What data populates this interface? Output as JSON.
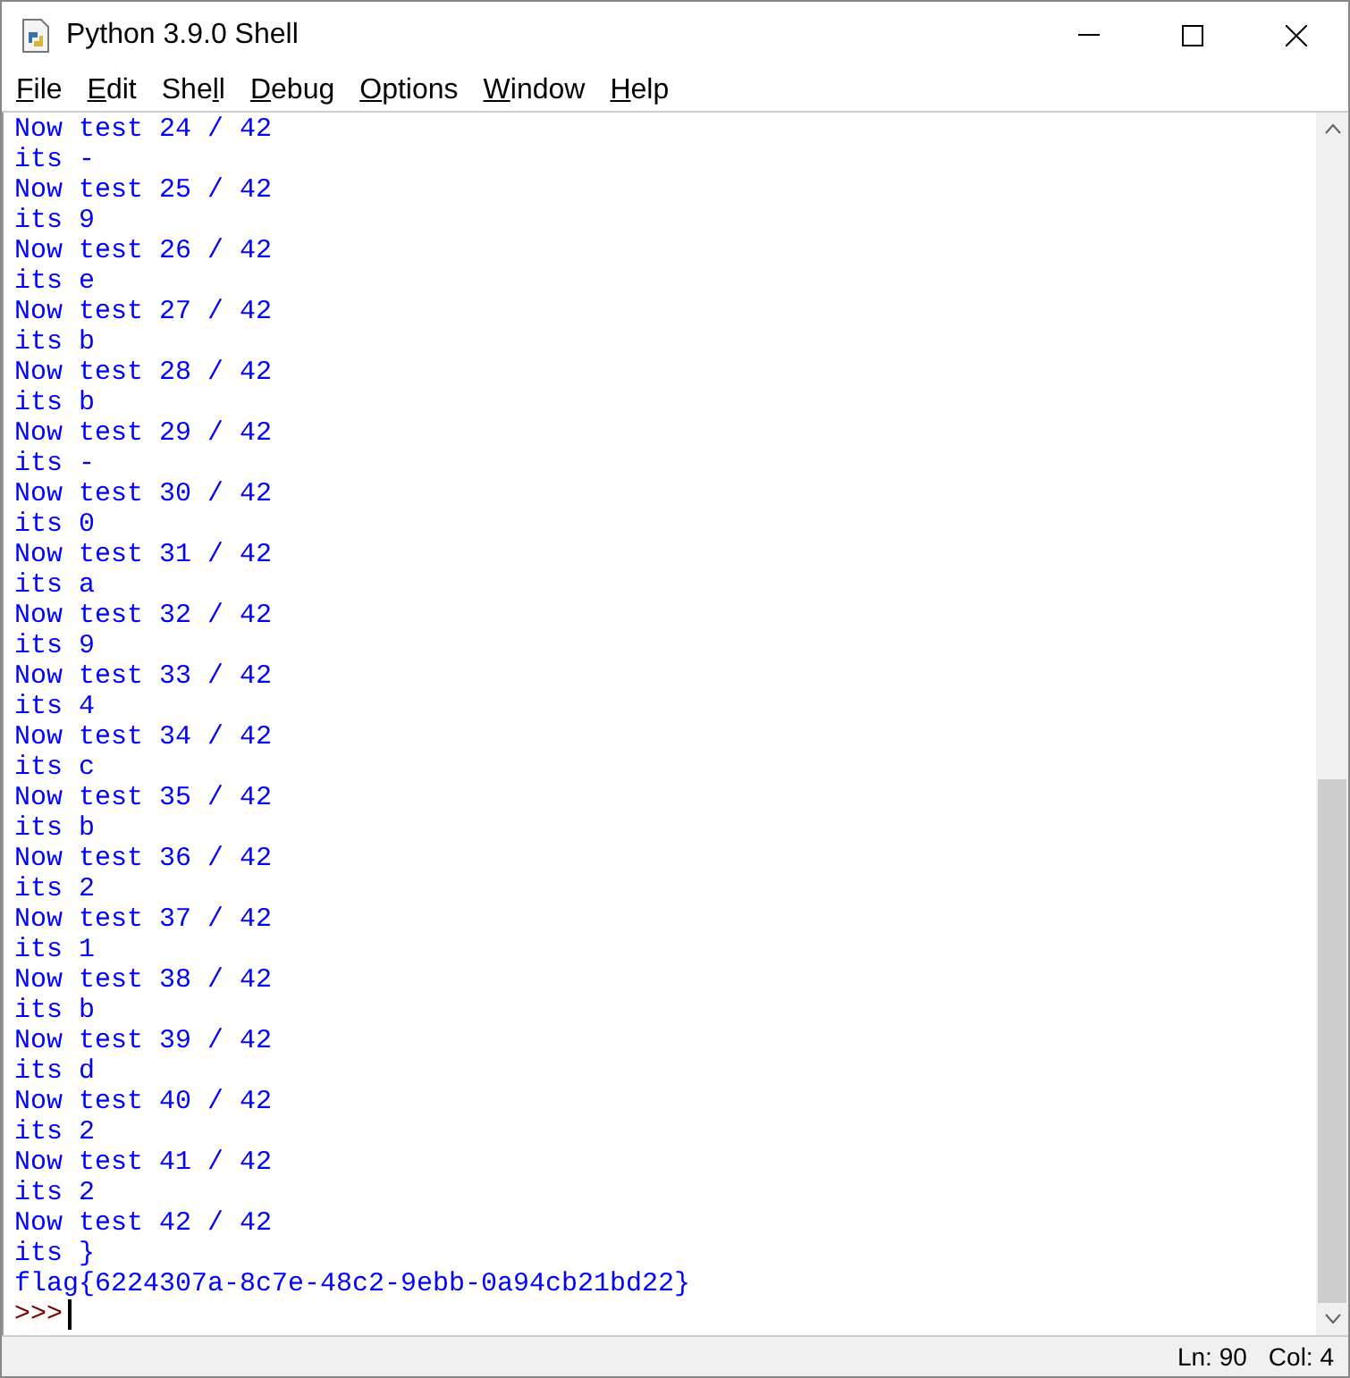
{
  "window": {
    "title": "Python 3.9.0 Shell"
  },
  "menu": [
    {
      "key": "F",
      "after": "ile"
    },
    {
      "key": "E",
      "after": "dit"
    },
    {
      "before": "She",
      "key": "l",
      "after": "l"
    },
    {
      "key": "D",
      "after": "ebug"
    },
    {
      "key": "O",
      "after": "ptions"
    },
    {
      "key": "W",
      "after": "indow"
    },
    {
      "key": "H",
      "after": "elp"
    }
  ],
  "output": [
    "Now test 24 / 42",
    "its -",
    "Now test 25 / 42",
    "its 9",
    "Now test 26 / 42",
    "its e",
    "Now test 27 / 42",
    "its b",
    "Now test 28 / 42",
    "its b",
    "Now test 29 / 42",
    "its -",
    "Now test 30 / 42",
    "its 0",
    "Now test 31 / 42",
    "its a",
    "Now test 32 / 42",
    "its 9",
    "Now test 33 / 42",
    "its 4",
    "Now test 34 / 42",
    "its c",
    "Now test 35 / 42",
    "its b",
    "Now test 36 / 42",
    "its 2",
    "Now test 37 / 42",
    "its 1",
    "Now test 38 / 42",
    "its b",
    "Now test 39 / 42",
    "its d",
    "Now test 40 / 42",
    "its 2",
    "Now test 41 / 42",
    "its 2",
    "Now test 42 / 42",
    "its }",
    "flag{6224307a-8c7e-48c2-9ebb-0a94cb21bd22}"
  ],
  "prompt": ">>>",
  "status_bar": {
    "line": "Ln: 90",
    "column": "Col: 4"
  }
}
